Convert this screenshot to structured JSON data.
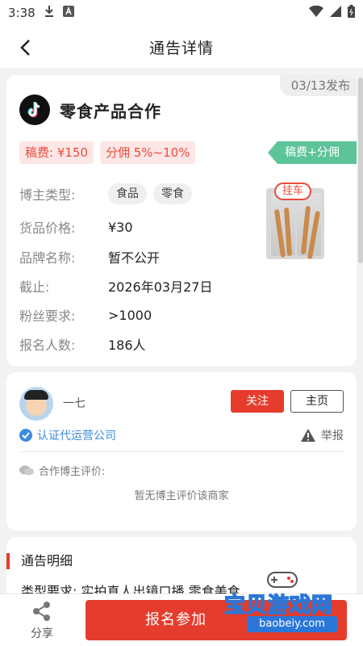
{
  "status_bar": {
    "time": "3:38"
  },
  "nav": {
    "title": "通告详情"
  },
  "announcement": {
    "date": "03/13发布",
    "title": "零食产品合作",
    "fee": "稿费: ¥150",
    "commission": "分佣 5%~10%",
    "pay_mode": "稿费+分佣",
    "hang_badge": "挂车",
    "fields": {
      "blogger_type_label": "博主类型:",
      "blogger_types": [
        "食品",
        "零食"
      ],
      "price_label": "货品价格:",
      "price_value": "¥30",
      "brand_label": "品牌名称:",
      "brand_value": "暂不公开",
      "deadline_label": "截止:",
      "deadline_value": "2026年03月27日",
      "fans_label": "粉丝要求:",
      "fans_value": ">1000",
      "signup_label": "报名人数:",
      "signup_value": "186人"
    }
  },
  "publisher": {
    "name": "一七",
    "follow_label": "关注",
    "home_label": "主页",
    "verified_label": "认证代运营公司",
    "report_label": "举报",
    "review_label": "合作博主评价:",
    "review_empty": "暂无博主评价该商家"
  },
  "details": {
    "section_title": "通告明细",
    "type_requirement": "类型要求: 实拍真人出镜口播 零食美食"
  },
  "bottom": {
    "share_label": "分享",
    "signup_label": "报名参加"
  },
  "watermark": {
    "text": "宝贝游戏网",
    "url": "baobeiy.com"
  },
  "colors": {
    "accent_red": "#e53c2e",
    "tag_green": "#5dc49a",
    "verified_blue": "#3b8de0"
  }
}
